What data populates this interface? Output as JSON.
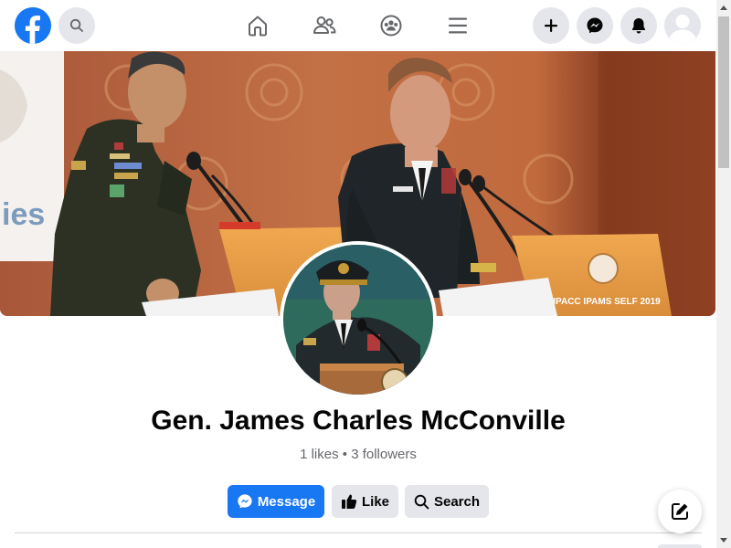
{
  "colors": {
    "brand": "#1877f2",
    "button_secondary": "#e4e6eb",
    "text_primary": "#050505",
    "text_secondary": "#65676b"
  },
  "topbar": {
    "logo_icon": "facebook-logo-icon",
    "search_icon": "search-icon",
    "nav": [
      {
        "name": "home",
        "icon": "home-icon"
      },
      {
        "name": "friends",
        "icon": "friends-icon"
      },
      {
        "name": "groups",
        "icon": "groups-icon"
      },
      {
        "name": "menu",
        "icon": "hamburger-menu-icon"
      }
    ],
    "actions": [
      {
        "name": "create",
        "icon": "plus-icon"
      },
      {
        "name": "messenger",
        "icon": "messenger-icon"
      },
      {
        "name": "notifications",
        "icon": "bell-icon"
      },
      {
        "name": "account",
        "icon": "avatar-icon"
      }
    ]
  },
  "cover": {
    "backdrop_text": "ies",
    "lectern_right_text": "IPACC IPAMS SELF 2019"
  },
  "profile": {
    "name": "Gen. James Charles McConville",
    "stats": "1 likes • 3 followers"
  },
  "buttons": {
    "message": "Message",
    "like": "Like",
    "search": "Search"
  },
  "fab": {
    "icon": "compose-icon"
  }
}
